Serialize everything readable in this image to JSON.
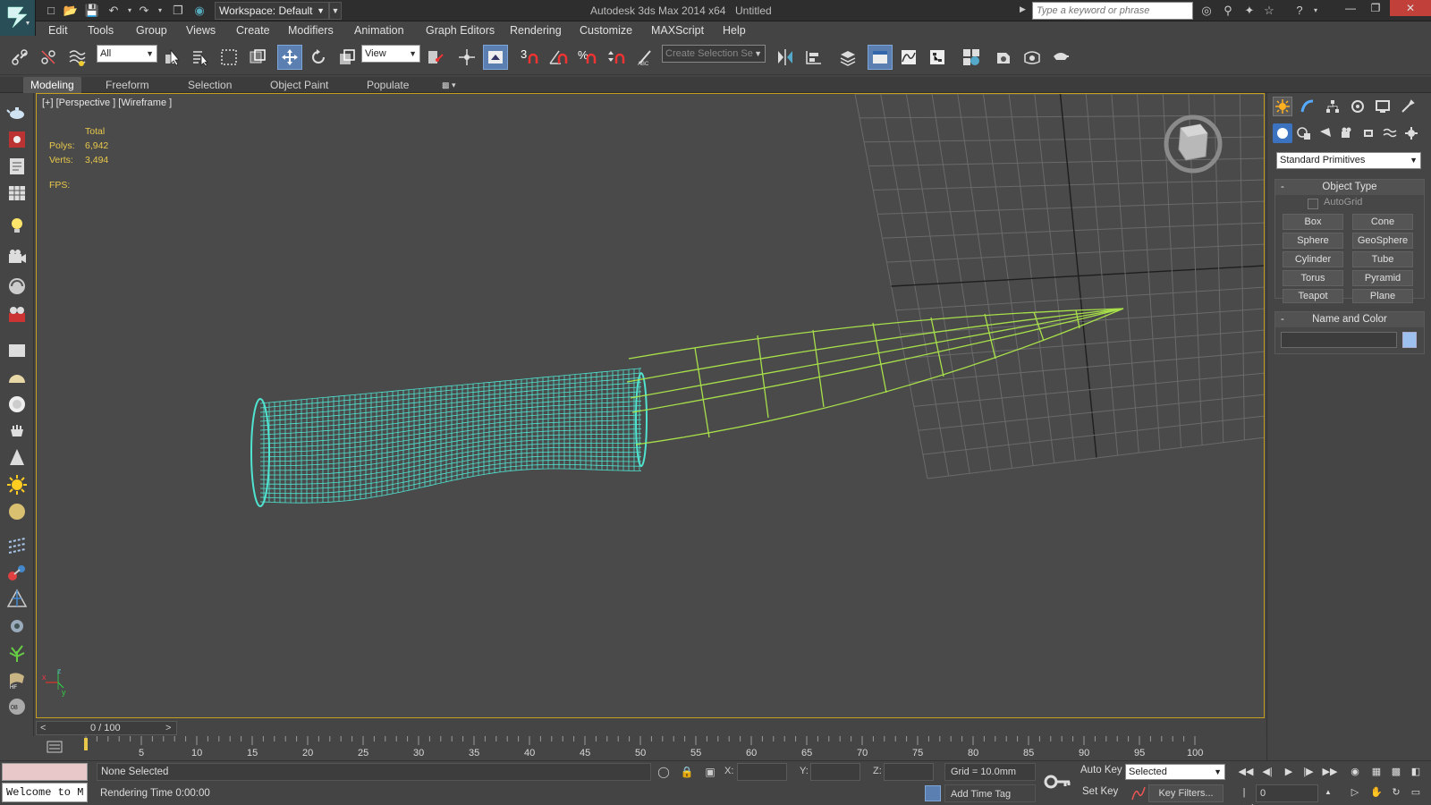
{
  "window": {
    "app_title": "Autodesk 3ds Max  2014 x64",
    "doc_title": "Untitled",
    "workspace": "Workspace: Default",
    "search_placeholder": "Type a keyword or phrase"
  },
  "menu": [
    "Edit",
    "Tools",
    "Group",
    "Views",
    "Create",
    "Modifiers",
    "Animation",
    "Graph Editors",
    "Rendering",
    "Customize",
    "MAXScript",
    "Help"
  ],
  "toolbar": {
    "selection_filter": "All",
    "ref_coord": "View",
    "snap_angle_label": "3",
    "named_selection_placeholder": "Create Selection Se"
  },
  "ribbon_tabs": [
    "Modeling",
    "Freeform",
    "Selection",
    "Object Paint",
    "Populate"
  ],
  "viewport": {
    "label": "[+] [Perspective ] [Wireframe ]",
    "stats_header": "Total",
    "polys_label": "Polys:",
    "polys_value": "6,942",
    "verts_label": "Verts:",
    "verts_value": "3,494",
    "fps_label": "FPS:",
    "axis_z": "z",
    "axis_x": "x",
    "axis_y": "y"
  },
  "command_panel": {
    "category": "Standard Primitives",
    "object_type_title": "Object Type",
    "autogrid_label": "AutoGrid",
    "primitives": [
      "Box",
      "Cone",
      "Sphere",
      "GeoSphere",
      "Cylinder",
      "Tube",
      "Torus",
      "Pyramid",
      "Teapot",
      "Plane"
    ],
    "name_color_title": "Name and Color",
    "swatch_color": "#9ec0ef"
  },
  "time": {
    "slider_label": "0 / 100",
    "prev": "<",
    "next": ">",
    "ticks": [
      "5",
      "10",
      "15",
      "20",
      "25",
      "30",
      "35",
      "40",
      "45",
      "50",
      "55",
      "60",
      "65",
      "70",
      "75",
      "80",
      "85",
      "90",
      "95",
      "100"
    ]
  },
  "status": {
    "maxscript_welcome": "Welcome to M",
    "selection": "None Selected",
    "rendering_time": "Rendering Time  0:00:00",
    "x_label": "X:",
    "y_label": "Y:",
    "z_label": "Z:",
    "grid": "Grid = 10.0mm",
    "add_time_tag": "Add Time Tag",
    "auto_key": "Auto Key",
    "set_key": "Set Key",
    "key_mode": "Selected",
    "key_filters": "Key Filters...",
    "current_frame": "0"
  },
  "colors": {
    "handle_wire": "#4fe3d0",
    "blade_wire": "#a8e04a",
    "viewport_border": "#c8a020",
    "stats_text": "#e8c84a"
  }
}
